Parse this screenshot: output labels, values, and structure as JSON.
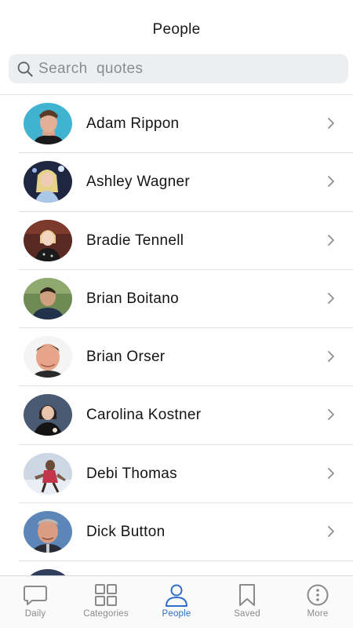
{
  "header": {
    "title": "People"
  },
  "search": {
    "placeholder": "Search  quotes"
  },
  "people": [
    {
      "name": "Adam Rippon"
    },
    {
      "name": "Ashley Wagner"
    },
    {
      "name": "Bradie Tennell"
    },
    {
      "name": "Brian Boitano"
    },
    {
      "name": "Brian Orser"
    },
    {
      "name": "Carolina Kostner"
    },
    {
      "name": "Debi Thomas"
    },
    {
      "name": "Dick Button"
    }
  ],
  "tabs": {
    "daily": "Daily",
    "categories": "Categories",
    "people": "People",
    "saved": "Saved",
    "more": "More"
  },
  "colors": {
    "accent": "#2f6ec8",
    "inactive": "#8a8a8a",
    "divider": "#e2e2e2",
    "search_bg": "#eceef0"
  },
  "icons": {
    "search": "search-icon",
    "chevron": "chevron-right-icon",
    "daily": "speech-bubble-icon",
    "categories": "grid-icon",
    "people": "person-icon",
    "saved": "bookmark-icon",
    "more": "more-dots-icon"
  }
}
